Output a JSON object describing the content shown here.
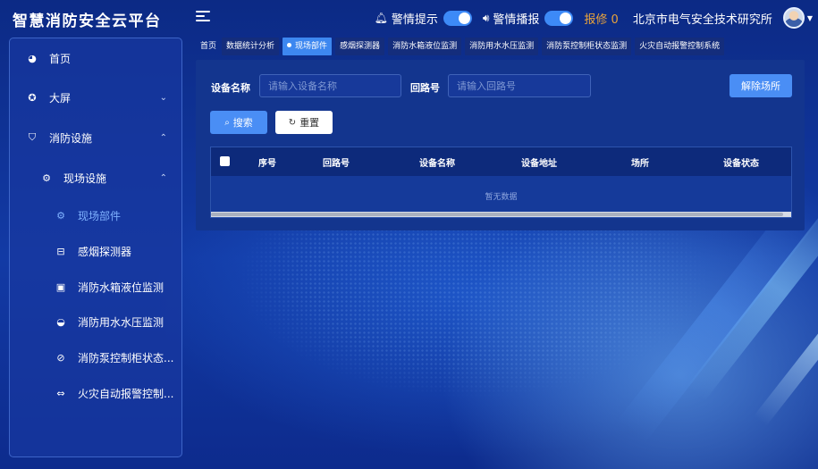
{
  "app": {
    "title": "智慧消防安全云平台"
  },
  "header": {
    "alert_tip_label": "警情提示",
    "alert_broadcast_label": "警情播报",
    "repair_label": "报修 0",
    "org_name": "北京市电气安全技术研究所",
    "colors": {
      "toggle_on": "#3d8af7",
      "repair": "#e8a33c"
    }
  },
  "sidebar": {
    "items": [
      {
        "label": "首页",
        "icon": "dashboard-icon"
      },
      {
        "label": "大屏",
        "icon": "screen-icon",
        "expand": "collapsed"
      },
      {
        "label": "消防设施",
        "icon": "shield-icon",
        "expand": "expanded"
      },
      {
        "label": "现场设施",
        "icon": "gear-icon",
        "expand": "expanded"
      },
      {
        "label": "现场部件",
        "icon": "gear-icon",
        "active": true
      },
      {
        "label": "感烟探测器",
        "icon": "smoke-detector-icon"
      },
      {
        "label": "消防水箱液位监测",
        "icon": "water-tank-icon"
      },
      {
        "label": "消防用水水压监测",
        "icon": "pressure-gauge-icon"
      },
      {
        "label": "消防泵控制柜状态...",
        "icon": "pump-icon"
      },
      {
        "label": "火灾自动报警控制...",
        "icon": "alarm-link-icon"
      }
    ]
  },
  "tabs": [
    {
      "label": "首页"
    },
    {
      "label": "数据统计分析"
    },
    {
      "label": "现场部件",
      "active": true
    },
    {
      "label": "感烟探测器"
    },
    {
      "label": "消防水箱液位监测"
    },
    {
      "label": "消防用水水压监测"
    },
    {
      "label": "消防泵控制柜状态监测"
    },
    {
      "label": "火灾自动报警控制系统"
    }
  ],
  "filters": {
    "device_name_label": "设备名称",
    "device_name_placeholder": "请输入设备名称",
    "loop_label": "回路号",
    "loop_placeholder": "请输入回路号",
    "unbind_button": "解除场所",
    "search_button": "搜索",
    "reset_button": "重置"
  },
  "table": {
    "columns": [
      "序号",
      "回路号",
      "设备名称",
      "设备地址",
      "场所",
      "设备状态"
    ],
    "empty_text": "暂无数据"
  }
}
